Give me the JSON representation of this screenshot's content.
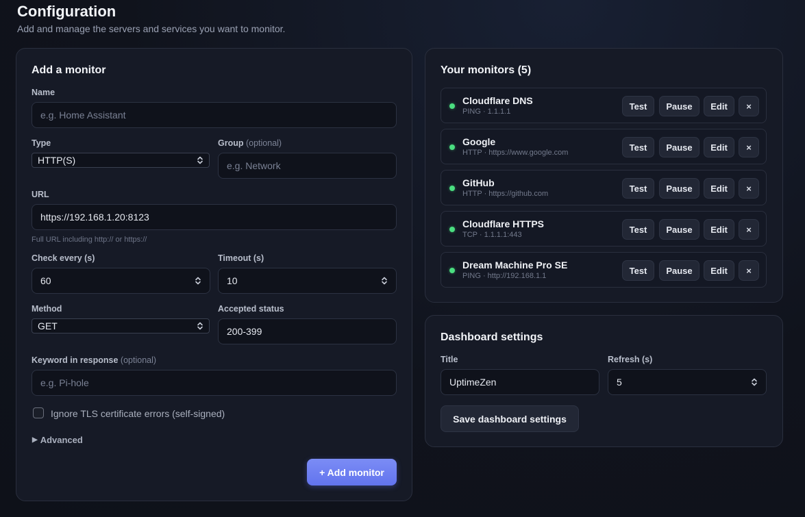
{
  "header": {
    "title": "Configuration",
    "subtitle": "Add and manage the servers and services you want to monitor."
  },
  "add_monitor": {
    "title": "Add a monitor",
    "name_label": "Name",
    "name_placeholder": "e.g. Home Assistant",
    "type_label": "Type",
    "type_value": "HTTP(S)",
    "group_label": "Group",
    "group_optional": "(optional)",
    "group_placeholder": "e.g. Network",
    "url_label": "URL",
    "url_value": "https://192.168.1.20:8123",
    "url_hint": "Full URL including http:// or https://",
    "check_every_label": "Check every (s)",
    "check_every_value": "60",
    "timeout_label": "Timeout (s)",
    "timeout_value": "10",
    "method_label": "Method",
    "method_value": "GET",
    "accepted_status_label": "Accepted status",
    "accepted_status_value": "200-399",
    "keyword_label": "Keyword in response",
    "keyword_optional": "(optional)",
    "keyword_placeholder": "e.g. Pi-hole",
    "ignore_tls_label": "Ignore TLS certificate errors (self-signed)",
    "ignore_tls_checked": false,
    "advanced_label": "Advanced",
    "submit_label": "+ Add monitor"
  },
  "monitors": {
    "title": "Your monitors (5)",
    "status_color": "#4ade80",
    "items": [
      {
        "name": "Cloudflare DNS",
        "detail": "PING · 1.1.1.1",
        "status": "up"
      },
      {
        "name": "Google",
        "detail": "HTTP · https://www.google.com",
        "status": "up"
      },
      {
        "name": "GitHub",
        "detail": "HTTP · https://github.com",
        "status": "up"
      },
      {
        "name": "Cloudflare HTTPS",
        "detail": "TCP · 1.1.1.1:443",
        "status": "up"
      },
      {
        "name": "Dream Machine Pro SE",
        "detail": "PING · http://192.168.1.1",
        "status": "up"
      }
    ],
    "actions": {
      "test": "Test",
      "pause": "Pause",
      "edit": "Edit",
      "remove": "×"
    }
  },
  "dashboard_settings": {
    "title": "Dashboard settings",
    "title_label": "Title",
    "title_value": "UptimeZen",
    "refresh_label": "Refresh (s)",
    "refresh_value": "5",
    "save_label": "Save dashboard settings"
  },
  "theme": {
    "accent": "#6b7cf0",
    "background": "#10131c",
    "card": "#161a26"
  }
}
